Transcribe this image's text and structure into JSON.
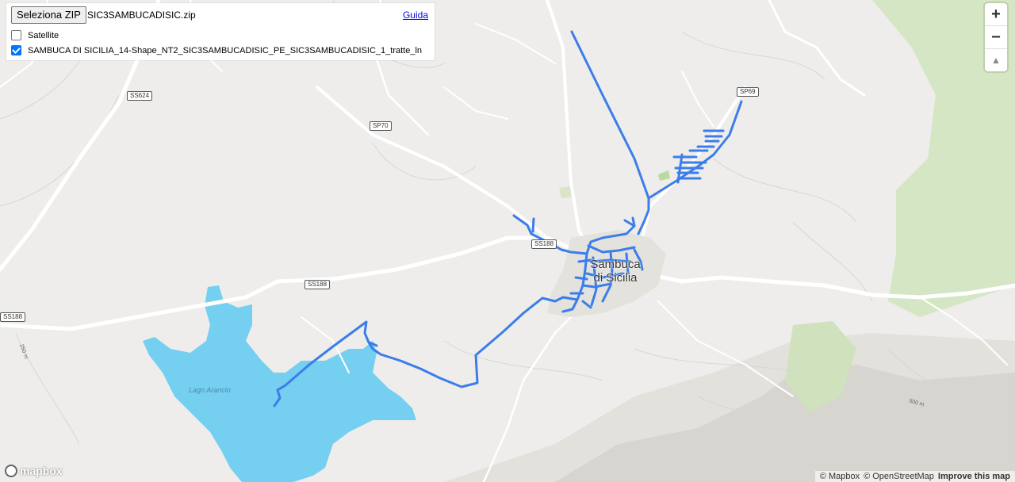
{
  "panel": {
    "zip_button": "Seleziona ZIP",
    "file_name": "SIC3SAMBUCADISIC.zip",
    "guide_link": "Guida",
    "layers": [
      {
        "label": "Satellite",
        "checked": false
      },
      {
        "label": "SAMBUCA DI SICILIA_14-Shape_NT2_SIC3SAMBUCADISIC_PE_SIC3SAMBUCADISIC_1_tratte_ln",
        "checked": true
      }
    ]
  },
  "map": {
    "road_badges": [
      "SS624",
      "SP70",
      "SP69",
      "SS188",
      "SS188",
      "SS188"
    ],
    "town_label_line1": "Sambuca",
    "town_label_line2": "di Sicilia",
    "lake_label": "Lago Arancio",
    "contour_labels": [
      "250 m",
      "500 m"
    ],
    "colors": {
      "background": "#eeedeb",
      "water": "#75cff0",
      "route": "#3b7dea",
      "road": "#ffffff",
      "park": "#d4e6c3"
    }
  },
  "controls": {
    "zoom_in": "+",
    "zoom_out": "−",
    "compass": "▲"
  },
  "footer": {
    "logo_text": "mapbox",
    "attribution_mapbox": "© Mapbox",
    "attribution_osm": "© OpenStreetMap",
    "improve_link": "Improve this map"
  }
}
